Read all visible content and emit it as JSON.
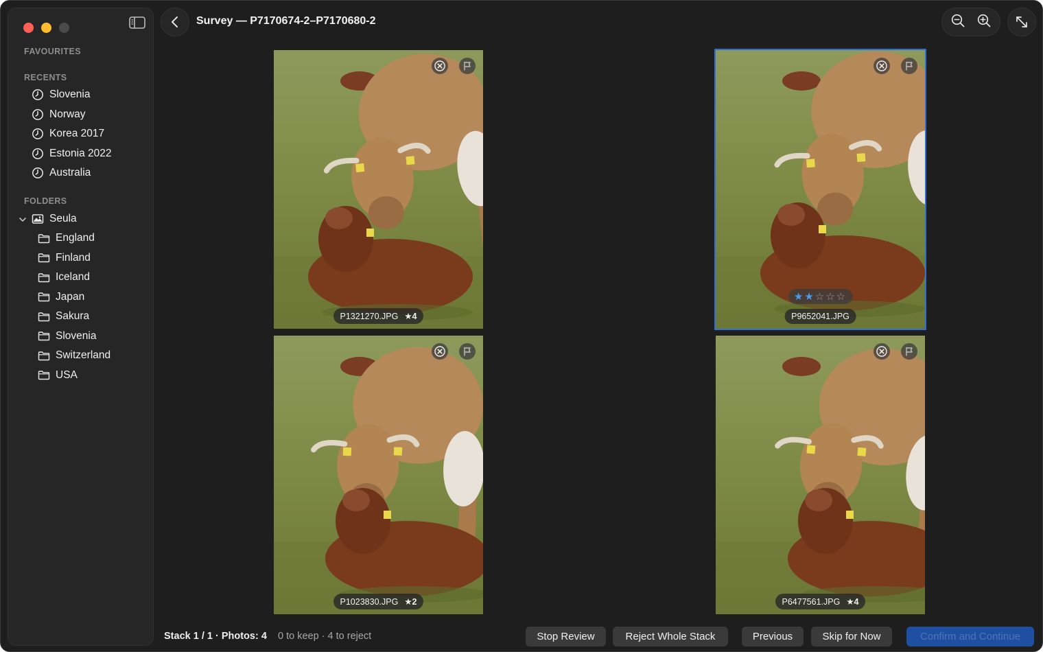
{
  "header": {
    "title": "Survey — P7170674-2–P7170680-2"
  },
  "sidebar": {
    "favourites_title": "FAVOURITES",
    "recents_title": "RECENTS",
    "recents": [
      {
        "label": "Slovenia",
        "icon": "clock-icon"
      },
      {
        "label": "Norway",
        "icon": "clock-icon"
      },
      {
        "label": "Korea 2017",
        "icon": "clock-icon"
      },
      {
        "label": "Estonia 2022",
        "icon": "clock-icon"
      },
      {
        "label": "Australia",
        "icon": "clock-icon"
      }
    ],
    "folders_title": "FOLDERS",
    "root_folder": {
      "label": "Seula",
      "icon": "photo-library-icon",
      "expanded": true
    },
    "folders": [
      {
        "label": "England",
        "icon": "folder-icon"
      },
      {
        "label": "Finland",
        "icon": "folder-icon"
      },
      {
        "label": "Iceland",
        "icon": "folder-icon"
      },
      {
        "label": "Japan",
        "icon": "folder-icon"
      },
      {
        "label": "Sakura",
        "icon": "folder-icon"
      },
      {
        "label": "Slovenia",
        "icon": "folder-icon"
      },
      {
        "label": "Switzerland",
        "icon": "folder-icon"
      },
      {
        "label": "USA",
        "icon": "folder-icon"
      }
    ]
  },
  "photos": [
    {
      "filename": "P1321270.JPG",
      "rating_label": "★4",
      "selected": false
    },
    {
      "filename": "P9652041.JPG",
      "rating_label": "",
      "selected": true,
      "stars": 2,
      "stars_max": 5
    },
    {
      "filename": "P1023830.JPG",
      "rating_label": "★2",
      "selected": false
    },
    {
      "filename": "P6477561.JPG",
      "rating_label": "★4",
      "selected": false
    }
  ],
  "footer": {
    "stack_info": "Stack 1 / 1 · Photos: 4",
    "keep_info": "0 to keep · 4 to reject",
    "stop_review": "Stop Review",
    "reject_stack": "Reject Whole Stack",
    "previous": "Previous",
    "skip": "Skip for Now",
    "confirm": "Confirm and Continue"
  },
  "colors": {
    "background": "#1e1e1e",
    "sidebar": "#262626",
    "accent": "#2f6fd6",
    "star_on": "#4a9cf0",
    "close": "#fe5f57",
    "minimize": "#febc2e"
  }
}
